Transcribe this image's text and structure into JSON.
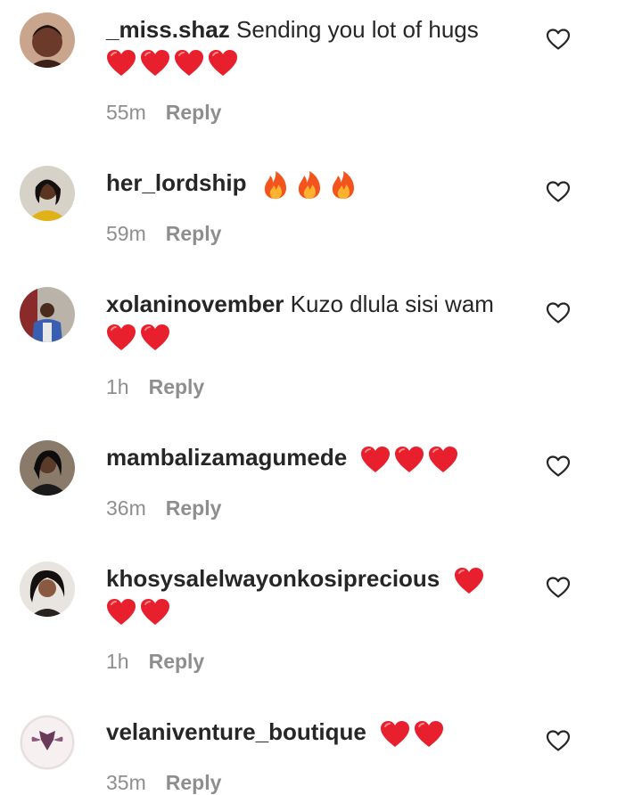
{
  "comments": [
    {
      "username": "_miss.shaz",
      "text": "Sending you lot of hugs",
      "emoji_line1": [],
      "emoji_line2": [
        "heart",
        "heart",
        "heart",
        "heart"
      ],
      "time": "55m",
      "reply": "Reply",
      "avatar_color": "#6b3a2a"
    },
    {
      "username": "her_lordship",
      "text": "",
      "emoji_line1": [
        "fire",
        "fire",
        "fire"
      ],
      "emoji_line2": [],
      "time": "59m",
      "reply": "Reply",
      "avatar_color": "#e0b21a"
    },
    {
      "username": "xolaninovember",
      "text": "Kuzo dlula sisi wam",
      "emoji_line1": [],
      "emoji_line2": [
        "heart",
        "heart"
      ],
      "time": "1h",
      "reply": "Reply",
      "avatar_color": "#3b5fb0"
    },
    {
      "username": "mambalizamagumede",
      "text": "",
      "emoji_line1": [
        "heart",
        "heart",
        "heart"
      ],
      "emoji_line2": [],
      "time": "36m",
      "reply": "Reply",
      "avatar_color": "#2a2a2a"
    },
    {
      "username": "khosysalelwayonkosiprecious",
      "text": "",
      "emoji_line1": [
        "heart"
      ],
      "emoji_line2": [
        "heart",
        "heart"
      ],
      "time": "1h",
      "reply": "Reply",
      "avatar_color": "#7a5a4a"
    },
    {
      "username": "velaniventure_boutique",
      "text": "",
      "emoji_line1": [
        "heart",
        "heart"
      ],
      "emoji_line2": [],
      "time": "35m",
      "reply": "Reply",
      "avatar_color": "#f3eaea"
    }
  ],
  "colors": {
    "heart": "#e8202e",
    "meta": "#8e8e8e",
    "text": "#262626"
  }
}
